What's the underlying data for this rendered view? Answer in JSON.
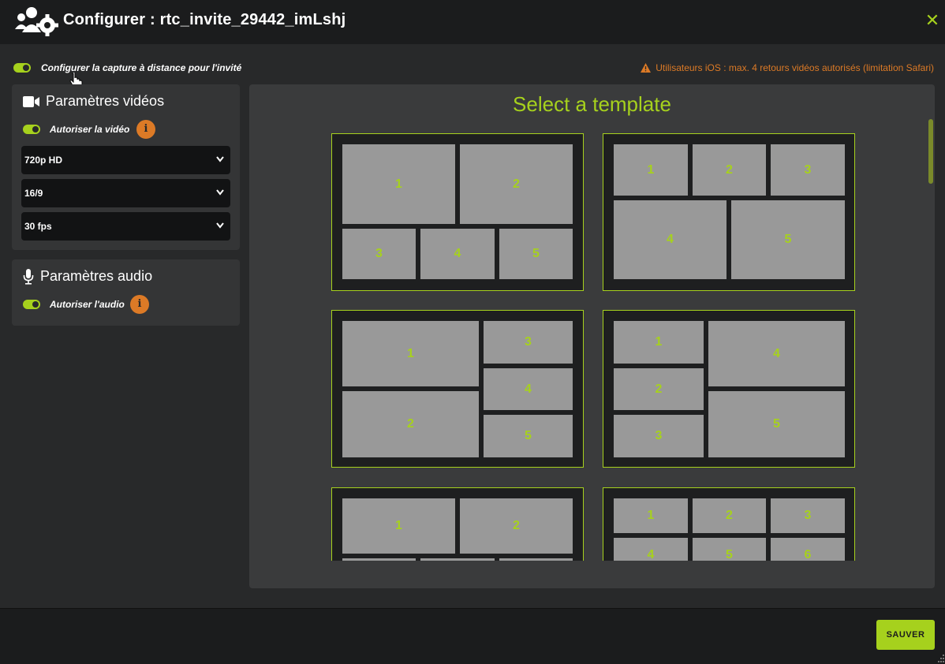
{
  "dialog": {
    "title": "Configurer : rtc_invite_29442_imLshj",
    "close_label": "✕"
  },
  "remote_capture": {
    "label": "Configurer la capture à distance pour l'invité",
    "enabled": true
  },
  "warning": {
    "text": "Utilisateurs iOS : max. 4 retours vidéos autorisés (limitation Safari)"
  },
  "video": {
    "heading": "Paramètres vidéos",
    "allow_label": "Autoriser la vidéo",
    "allow_enabled": true,
    "info": "i",
    "resolution": "720p HD",
    "ratio": "16/9",
    "fps": "30 fps"
  },
  "audio": {
    "heading": "Paramètres audio",
    "allow_label": "Autoriser l'audio",
    "allow_enabled": true,
    "info": "i"
  },
  "templates": {
    "heading": "Select a template",
    "t1": [
      "1",
      "2",
      "3",
      "4",
      "5"
    ],
    "t2": [
      "1",
      "2",
      "3",
      "4",
      "5"
    ],
    "t3": [
      "1",
      "2",
      "3",
      "4",
      "5"
    ],
    "t4": [
      "1",
      "2",
      "3",
      "4",
      "5"
    ],
    "t5": [
      "1",
      "2"
    ],
    "t6": [
      "1",
      "2",
      "3",
      "4",
      "5",
      "6"
    ]
  },
  "footer": {
    "save_label": "SAUVER"
  },
  "colors": {
    "accent": "#a6d11d",
    "warning": "#dc7a26",
    "background": "#28292a",
    "panel": "#343536"
  }
}
